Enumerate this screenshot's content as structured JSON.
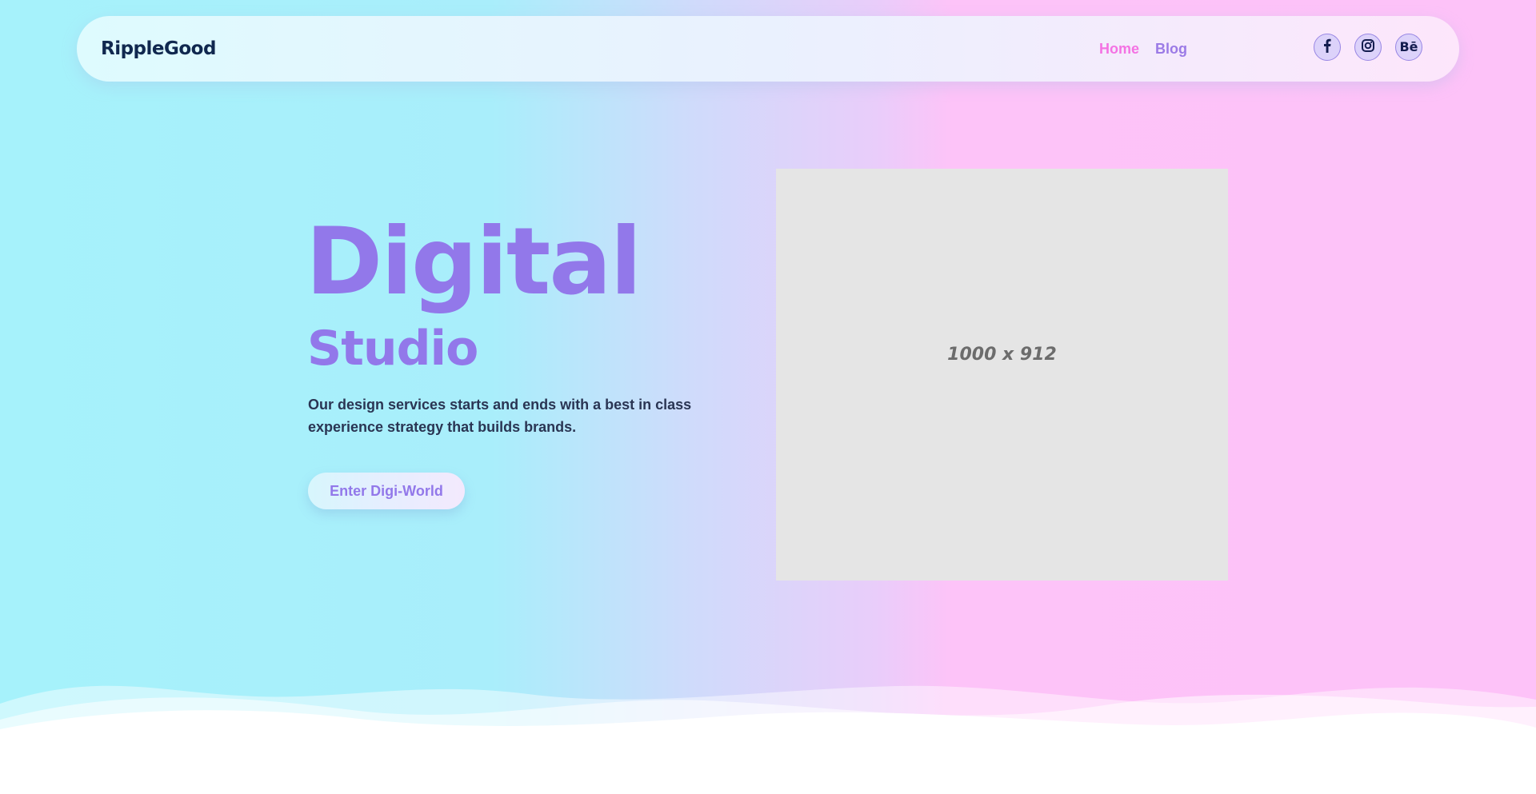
{
  "brand": {
    "name": "RippleGood"
  },
  "nav": {
    "links": [
      {
        "label": "Home",
        "active": true
      },
      {
        "label": "Blog",
        "active": false
      }
    ]
  },
  "socials": [
    {
      "name": "facebook-icon"
    },
    {
      "name": "instagram-icon"
    },
    {
      "name": "behance-icon",
      "glyph": "Bē"
    }
  ],
  "hero": {
    "title": "Digital",
    "subtitle": "Studio",
    "description": "Our design services starts and ends with a best in class experience strategy that builds brands.",
    "cta_label": "Enter Digi-World"
  },
  "image_placeholder": {
    "label": "1000 x 912"
  },
  "colors": {
    "accent_purple": "#9278ea",
    "accent_pink": "#f472e3",
    "brand_navy": "#10284f",
    "bg_cyan": "#a6f2fb",
    "bg_pink": "#fdc2f8"
  }
}
